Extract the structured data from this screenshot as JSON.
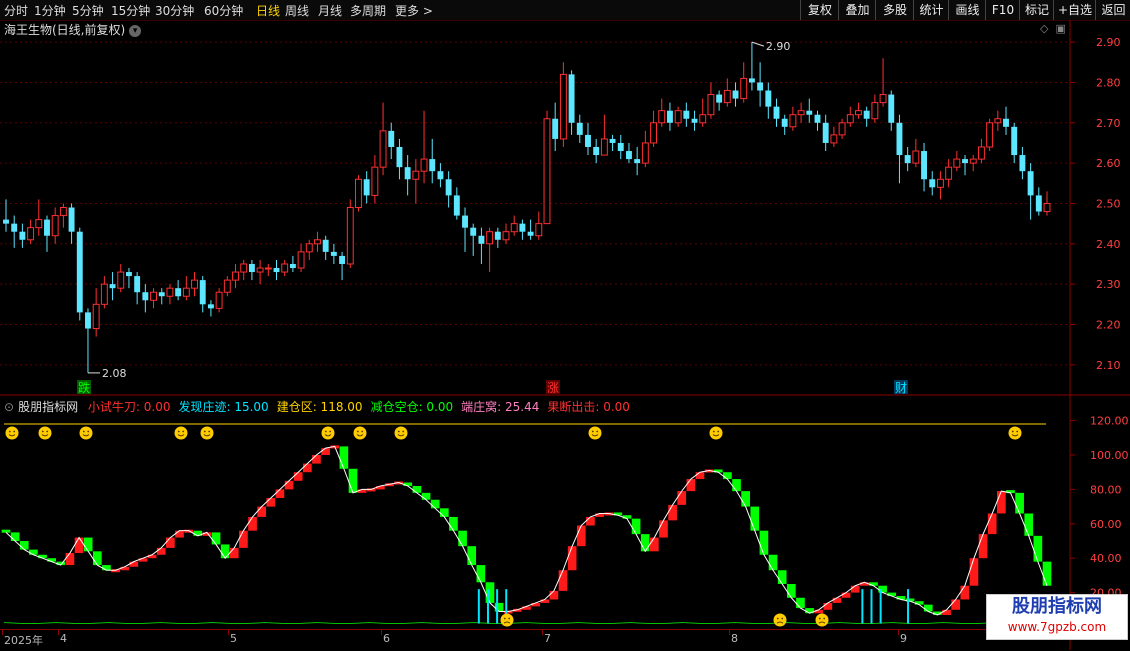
{
  "toolbar": {
    "left_items": [
      "分时",
      "1分钟",
      "5分钟",
      "15分钟",
      "30分钟",
      "60分钟",
      "日线",
      "周线",
      "月线",
      "多周期",
      "更多 >"
    ],
    "active": "日线",
    "right_items": [
      "复权",
      "叠加",
      "多股",
      "统计",
      "画线",
      "F10",
      "标记",
      "+自选",
      "返回"
    ]
  },
  "stock": {
    "title": "海王生物(日线,前复权)"
  },
  "indicator": {
    "name": "股朋指标网",
    "items": [
      {
        "label": "小试牛刀: 0.00",
        "color": "#ff3030"
      },
      {
        "label": "发现庄迹: 15.00",
        "color": "#00e5ff"
      },
      {
        "label": "建仓区: 118.00",
        "color": "#ffd400"
      },
      {
        "label": "减仓空仓: 0.00",
        "color": "#00ff00"
      },
      {
        "label": "端庄窝: 25.44",
        "color": "#ff80c0"
      },
      {
        "label": "果断出击: 0.00",
        "color": "#ff3030"
      }
    ]
  },
  "markers": [
    {
      "label": "跌",
      "color": "#00ff00",
      "bg": "#006000"
    },
    {
      "label": "涨",
      "color": "#ff3030",
      "bg": "#600000"
    },
    {
      "label": "财",
      "color": "#00e5ff",
      "bg": "#003a60"
    }
  ],
  "dates": [
    "2025年",
    "4",
    "5",
    "6",
    "7",
    "8",
    "9"
  ],
  "logo": {
    "line1": "股朋指标网",
    "line2": "www.7gpzb.com"
  },
  "chart_data": [
    {
      "type": "candlestick",
      "y_ticks": [
        "2.90",
        "2.80",
        "2.70",
        "2.60",
        "2.50",
        "2.40",
        "2.30",
        "2.20",
        "2.10"
      ],
      "ylim": [
        2.05,
        2.93
      ],
      "annotations": [
        {
          "text": "2.90",
          "kind": "max"
        },
        {
          "text": "2.08",
          "kind": "min"
        }
      ],
      "colors": {
        "up": "#ff3030",
        "down": "#5ce6ff"
      },
      "ohlc": [
        [
          2.46,
          2.45,
          2.51,
          2.43
        ],
        [
          2.45,
          2.43,
          2.47,
          2.39
        ],
        [
          2.43,
          2.41,
          2.45,
          2.39
        ],
        [
          2.41,
          2.44,
          2.46,
          2.4
        ],
        [
          2.44,
          2.46,
          2.51,
          2.42
        ],
        [
          2.46,
          2.42,
          2.47,
          2.38
        ],
        [
          2.42,
          2.47,
          2.49,
          2.4
        ],
        [
          2.47,
          2.49,
          2.5,
          2.44
        ],
        [
          2.49,
          2.43,
          2.5,
          2.4
        ],
        [
          2.43,
          2.23,
          2.44,
          2.21
        ],
        [
          2.23,
          2.19,
          2.24,
          2.08
        ],
        [
          2.19,
          2.25,
          2.29,
          2.17
        ],
        [
          2.25,
          2.3,
          2.32,
          2.24
        ],
        [
          2.3,
          2.29,
          2.33,
          2.26
        ],
        [
          2.29,
          2.33,
          2.35,
          2.28
        ],
        [
          2.33,
          2.32,
          2.34,
          2.29
        ],
        [
          2.32,
          2.28,
          2.33,
          2.25
        ],
        [
          2.28,
          2.26,
          2.3,
          2.23
        ],
        [
          2.26,
          2.28,
          2.29,
          2.24
        ],
        [
          2.28,
          2.27,
          2.29,
          2.25
        ],
        [
          2.27,
          2.29,
          2.3,
          2.25
        ],
        [
          2.29,
          2.27,
          2.31,
          2.26
        ],
        [
          2.27,
          2.29,
          2.32,
          2.26
        ],
        [
          2.29,
          2.31,
          2.33,
          2.27
        ],
        [
          2.31,
          2.25,
          2.32,
          2.23
        ],
        [
          2.25,
          2.24,
          2.26,
          2.22
        ],
        [
          2.24,
          2.28,
          2.29,
          2.23
        ],
        [
          2.28,
          2.31,
          2.32,
          2.27
        ],
        [
          2.31,
          2.33,
          2.35,
          2.29
        ],
        [
          2.33,
          2.35,
          2.36,
          2.31
        ],
        [
          2.35,
          2.33,
          2.36,
          2.31
        ],
        [
          2.33,
          2.34,
          2.36,
          2.3
        ],
        [
          2.34,
          2.34,
          2.35,
          2.32
        ],
        [
          2.34,
          2.33,
          2.36,
          2.31
        ],
        [
          2.33,
          2.35,
          2.36,
          2.32
        ],
        [
          2.35,
          2.34,
          2.37,
          2.33
        ],
        [
          2.34,
          2.38,
          2.4,
          2.33
        ],
        [
          2.38,
          2.4,
          2.41,
          2.36
        ],
        [
          2.4,
          2.41,
          2.43,
          2.38
        ],
        [
          2.41,
          2.38,
          2.42,
          2.36
        ],
        [
          2.38,
          2.37,
          2.4,
          2.35
        ],
        [
          2.37,
          2.35,
          2.38,
          2.31
        ],
        [
          2.35,
          2.49,
          2.51,
          2.34
        ],
        [
          2.49,
          2.56,
          2.57,
          2.48
        ],
        [
          2.56,
          2.52,
          2.58,
          2.5
        ],
        [
          2.52,
          2.59,
          2.62,
          2.5
        ],
        [
          2.59,
          2.68,
          2.75,
          2.57
        ],
        [
          2.68,
          2.64,
          2.7,
          2.61
        ],
        [
          2.64,
          2.59,
          2.66,
          2.56
        ],
        [
          2.59,
          2.56,
          2.62,
          2.52
        ],
        [
          2.56,
          2.58,
          2.61,
          2.5
        ],
        [
          2.58,
          2.61,
          2.73,
          2.55
        ],
        [
          2.61,
          2.58,
          2.66,
          2.55
        ],
        [
          2.58,
          2.56,
          2.6,
          2.54
        ],
        [
          2.56,
          2.52,
          2.58,
          2.49
        ],
        [
          2.52,
          2.47,
          2.54,
          2.46
        ],
        [
          2.47,
          2.44,
          2.49,
          2.38
        ],
        [
          2.44,
          2.42,
          2.45,
          2.37
        ],
        [
          2.42,
          2.4,
          2.44,
          2.35
        ],
        [
          2.4,
          2.43,
          2.44,
          2.33
        ],
        [
          2.43,
          2.41,
          2.44,
          2.39
        ],
        [
          2.41,
          2.43,
          2.45,
          2.4
        ],
        [
          2.43,
          2.45,
          2.47,
          2.42
        ],
        [
          2.45,
          2.43,
          2.46,
          2.41
        ],
        [
          2.43,
          2.42,
          2.46,
          2.41
        ],
        [
          2.42,
          2.45,
          2.48,
          2.41
        ],
        [
          2.45,
          2.71,
          2.73,
          2.57
        ],
        [
          2.71,
          2.66,
          2.75,
          2.63
        ],
        [
          2.66,
          2.82,
          2.85,
          2.64
        ],
        [
          2.82,
          2.7,
          2.83,
          2.67
        ],
        [
          2.7,
          2.67,
          2.72,
          2.65
        ],
        [
          2.67,
          2.64,
          2.7,
          2.62
        ],
        [
          2.64,
          2.62,
          2.66,
          2.6
        ],
        [
          2.62,
          2.66,
          2.72,
          2.62
        ],
        [
          2.66,
          2.65,
          2.67,
          2.63
        ],
        [
          2.65,
          2.63,
          2.67,
          2.61
        ],
        [
          2.63,
          2.61,
          2.65,
          2.6
        ],
        [
          2.61,
          2.6,
          2.64,
          2.57
        ],
        [
          2.6,
          2.65,
          2.68,
          2.59
        ],
        [
          2.65,
          2.7,
          2.73,
          2.64
        ],
        [
          2.7,
          2.73,
          2.76,
          2.69
        ],
        [
          2.73,
          2.7,
          2.75,
          2.68
        ],
        [
          2.7,
          2.73,
          2.74,
          2.69
        ],
        [
          2.73,
          2.71,
          2.75,
          2.69
        ],
        [
          2.71,
          2.7,
          2.73,
          2.68
        ],
        [
          2.7,
          2.72,
          2.76,
          2.69
        ],
        [
          2.72,
          2.77,
          2.8,
          2.71
        ],
        [
          2.77,
          2.75,
          2.78,
          2.73
        ],
        [
          2.75,
          2.78,
          2.81,
          2.74
        ],
        [
          2.78,
          2.76,
          2.8,
          2.74
        ],
        [
          2.76,
          2.81,
          2.85,
          2.75
        ],
        [
          2.81,
          2.8,
          2.9,
          2.78
        ],
        [
          2.8,
          2.78,
          2.85,
          2.74
        ],
        [
          2.78,
          2.74,
          2.8,
          2.71
        ],
        [
          2.74,
          2.71,
          2.76,
          2.69
        ],
        [
          2.71,
          2.69,
          2.72,
          2.67
        ],
        [
          2.69,
          2.72,
          2.74,
          2.68
        ],
        [
          2.72,
          2.73,
          2.75,
          2.7
        ],
        [
          2.73,
          2.72,
          2.76,
          2.7
        ],
        [
          2.72,
          2.7,
          2.73,
          2.68
        ],
        [
          2.7,
          2.65,
          2.72,
          2.63
        ],
        [
          2.65,
          2.67,
          2.69,
          2.64
        ],
        [
          2.67,
          2.7,
          2.71,
          2.66
        ],
        [
          2.7,
          2.72,
          2.74,
          2.69
        ],
        [
          2.72,
          2.73,
          2.75,
          2.71
        ],
        [
          2.73,
          2.71,
          2.74,
          2.69
        ],
        [
          2.71,
          2.75,
          2.77,
          2.7
        ],
        [
          2.75,
          2.77,
          2.86,
          2.74
        ],
        [
          2.77,
          2.7,
          2.78,
          2.68
        ],
        [
          2.7,
          2.62,
          2.72,
          2.55
        ],
        [
          2.62,
          2.6,
          2.64,
          2.58
        ],
        [
          2.6,
          2.63,
          2.66,
          2.59
        ],
        [
          2.63,
          2.56,
          2.65,
          2.53
        ],
        [
          2.56,
          2.54,
          2.58,
          2.52
        ],
        [
          2.54,
          2.56,
          2.58,
          2.51
        ],
        [
          2.56,
          2.59,
          2.61,
          2.54
        ],
        [
          2.59,
          2.61,
          2.63,
          2.58
        ],
        [
          2.61,
          2.6,
          2.62,
          2.57
        ],
        [
          2.6,
          2.61,
          2.62,
          2.58
        ],
        [
          2.61,
          2.64,
          2.66,
          2.6
        ],
        [
          2.64,
          2.7,
          2.71,
          2.63
        ],
        [
          2.7,
          2.71,
          2.73,
          2.68
        ],
        [
          2.71,
          2.69,
          2.74,
          2.67
        ],
        [
          2.69,
          2.62,
          2.7,
          2.6
        ],
        [
          2.62,
          2.58,
          2.64,
          2.56
        ],
        [
          2.58,
          2.52,
          2.6,
          2.46
        ],
        [
          2.52,
          2.48,
          2.54,
          2.47
        ],
        [
          2.48,
          2.5,
          2.53,
          2.47
        ]
      ]
    },
    {
      "type": "line",
      "y_ticks": [
        "120.00",
        "100.00",
        "80.00",
        "60.00",
        "40.00",
        "20.00"
      ],
      "ylim": [
        0,
        125
      ],
      "colors": {
        "up": "#ff1a1a",
        "down": "#00ff00",
        "line": "#ffffff",
        "threshold": "#ffd400",
        "bottom": "#00c000",
        "cyan": "#00e5ff"
      },
      "threshold": 118,
      "values": [
        55,
        50,
        45,
        42,
        40,
        38,
        36,
        43,
        52,
        44,
        36,
        33,
        33,
        35,
        38,
        40,
        42,
        46,
        52,
        56,
        56,
        53,
        55,
        48,
        40,
        46,
        56,
        64,
        70,
        75,
        80,
        85,
        90,
        95,
        100,
        104,
        105,
        92,
        78,
        80,
        80,
        82,
        83,
        84,
        82,
        78,
        74,
        69,
        64,
        56,
        47,
        36,
        26,
        14,
        9,
        9,
        10,
        12,
        14,
        16,
        21,
        33,
        47,
        59,
        64,
        66,
        66,
        65,
        63,
        54,
        44,
        52,
        62,
        71,
        79,
        86,
        90,
        91,
        90,
        86,
        79,
        70,
        56,
        42,
        33,
        25,
        17,
        11,
        8,
        10,
        14,
        17,
        20,
        24,
        26,
        24,
        20,
        18,
        16,
        15,
        13,
        9,
        7,
        10,
        16,
        24,
        40,
        54,
        66,
        79,
        78,
        66,
        53,
        38,
        24
      ]
    }
  ]
}
